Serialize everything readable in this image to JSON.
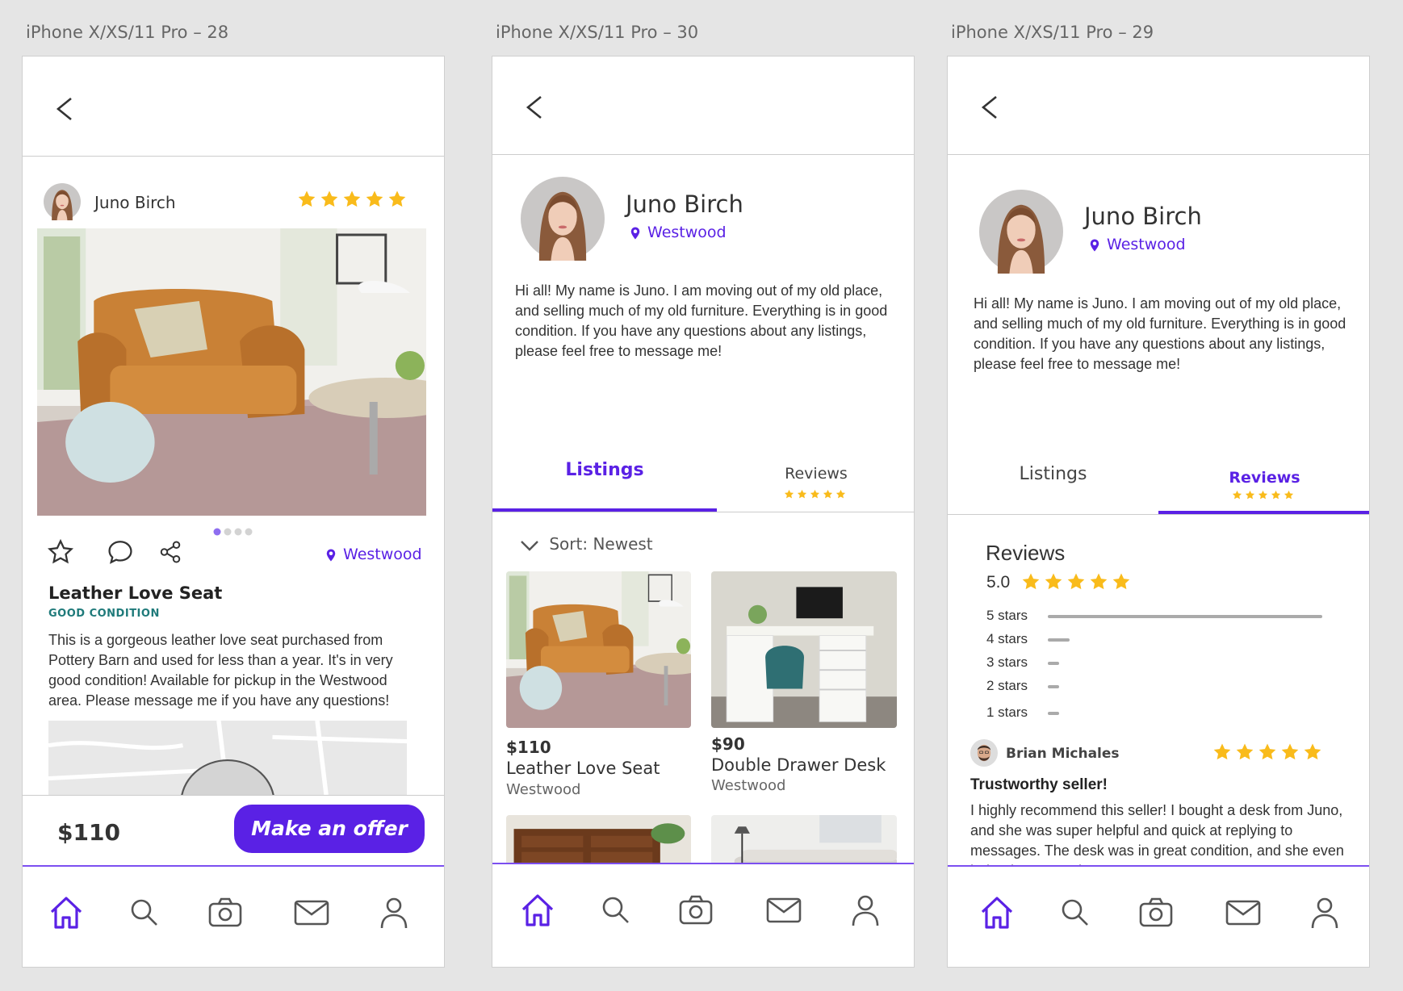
{
  "artboards": [
    {
      "label": "iPhone X/XS/11 Pro – 28"
    },
    {
      "label": "iPhone X/XS/11 Pro – 30"
    },
    {
      "label": "iPhone X/XS/11 Pro – 29"
    }
  ],
  "seller": {
    "name": "Juno Birch",
    "location": "Westwood",
    "bio": "Hi all! My name is Juno. I am moving out of my old place, and selling much of my old furniture. Everything is in good condition. If you have any questions about any listings, please feel free to message me!",
    "rating": 5
  },
  "listing": {
    "title": "Leather Love Seat",
    "condition": "GOOD CONDITION",
    "location": "Westwood",
    "description": "This is a gorgeous leather love seat purchased from Pottery Barn and used for less than a year. It's in very good condition! Available for pickup in the Westwood area. Please message me if you have any questions!",
    "price": "$110",
    "offer_label": "Make an offer",
    "carousel_index": 1,
    "carousel_count": 4
  },
  "tabs": {
    "listings": "Listings",
    "reviews": "Reviews"
  },
  "sort_label": "Sort: Newest",
  "listings": [
    {
      "price": "$110",
      "title": "Leather Love Seat",
      "location": "Westwood"
    },
    {
      "price": "$90",
      "title": "Double Drawer Desk",
      "location": "Westwood"
    }
  ],
  "reviews": {
    "heading": "Reviews",
    "average": "5.0",
    "breakdown": [
      {
        "label": "5 stars",
        "fraction": 1.0
      },
      {
        "label": "4 stars",
        "fraction": 0.08
      },
      {
        "label": "3 stars",
        "fraction": 0.04
      },
      {
        "label": "2 stars",
        "fraction": 0.04
      },
      {
        "label": "1 stars",
        "fraction": 0.04
      }
    ],
    "items": [
      {
        "author": "Brian Michales",
        "rating": 5,
        "title": "Trustworthy seller!",
        "body": "I highly recommend this seller! I bought a desk from Juno, and she was super helpful and quick at replying to messages. The desk was in great condition, and she even helped me carry it to my car."
      }
    ]
  },
  "nav": [
    "home-icon",
    "search-icon",
    "camera-icon",
    "mail-icon",
    "user-icon"
  ],
  "colors": {
    "accent": "#5a21e5",
    "star": "#f9bb1b",
    "condition": "#1f7a7a"
  }
}
